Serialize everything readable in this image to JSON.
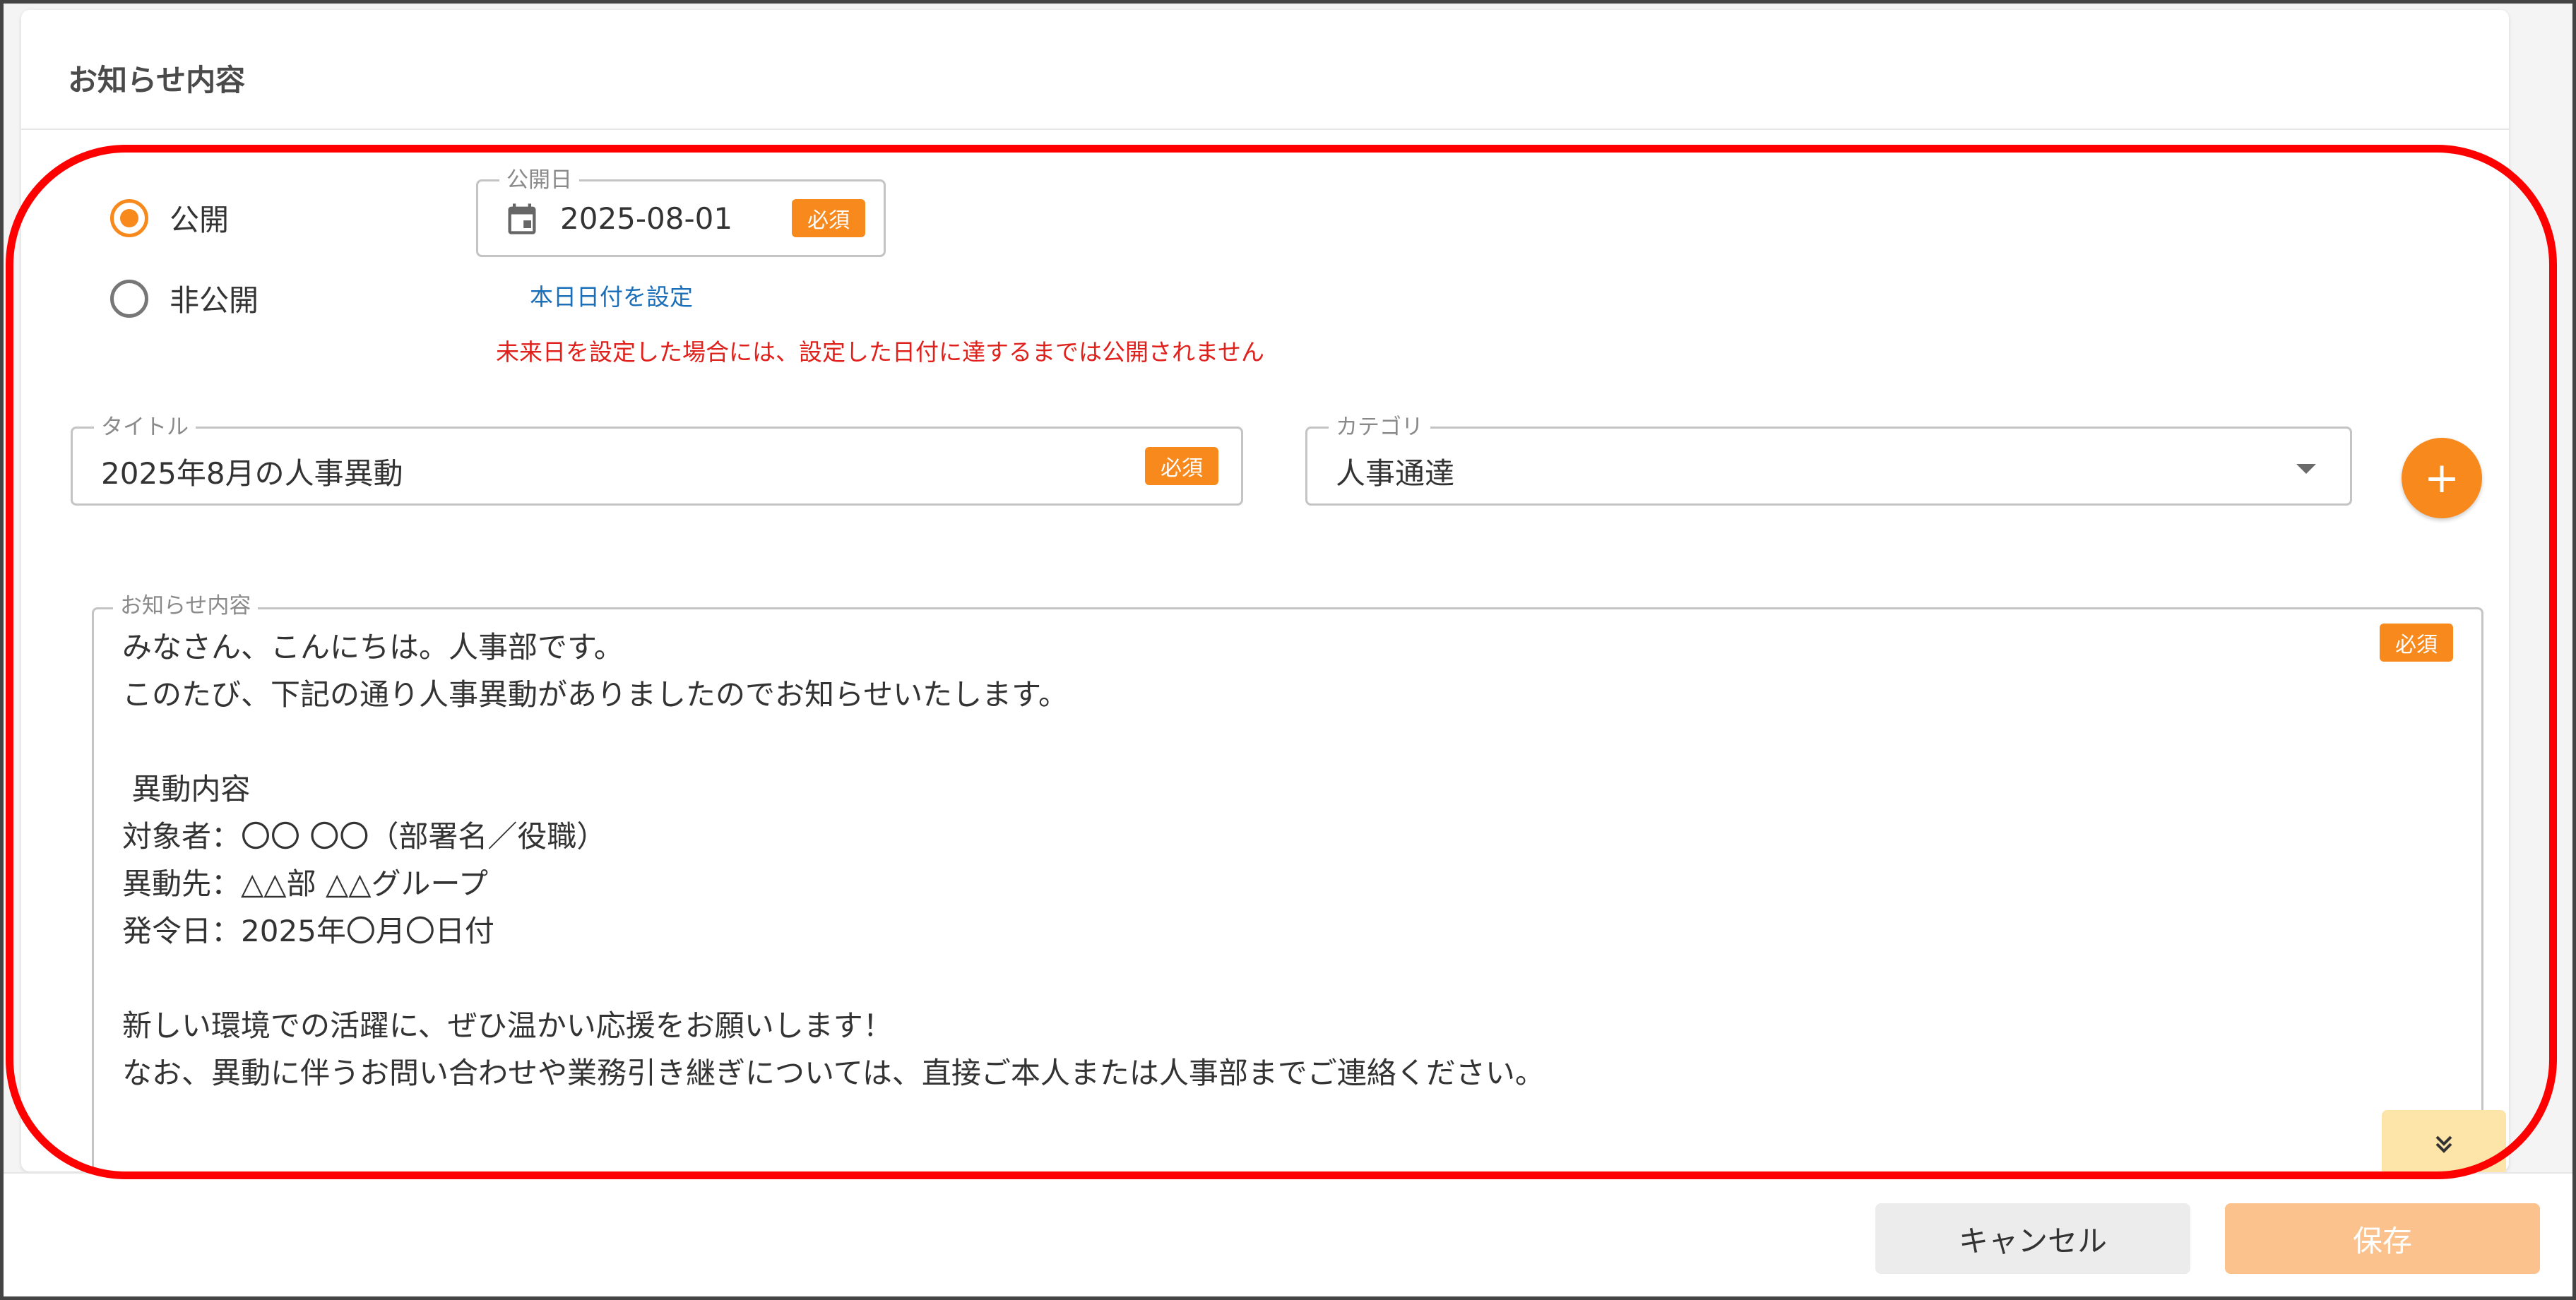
{
  "card": {
    "title": "お知らせ内容"
  },
  "visibility": {
    "options": [
      {
        "label": "公開",
        "checked": true
      },
      {
        "label": "非公開",
        "checked": false
      }
    ]
  },
  "publish_date": {
    "label": "公開日",
    "value": "2025-08-01",
    "required_badge": "必須",
    "today_link": "本日日付を設定",
    "warning": "未来日を設定した場合には、設定した日付に達するまでは公開されません"
  },
  "title_field": {
    "label": "タイトル",
    "value": "2025年8月の人事異動",
    "required_badge": "必須"
  },
  "category_field": {
    "label": "カテゴリ",
    "value": "人事通達"
  },
  "add_category_button": {
    "label": "+"
  },
  "content_field": {
    "label": "お知らせ内容",
    "required_badge": "必須",
    "value": "みなさん、こんにちは。人事部です。\nこのたび、下記の通り人事異動がありましたのでお知らせいたします。\n\n 異動内容\n対象者：〇〇 〇〇（部署名／役職）\n異動先：△△部 △△グループ\n発令日：2025年〇月〇日付\n\n新しい環境での活躍に、ぜひ温かい応援をお願いします！\nなお、異動に伴うお問い合わせや業務引き継ぎについては、直接ご本人または人事部までご連絡ください。\n\n________________________________________"
  },
  "footer": {
    "cancel_label": "キャンセル",
    "save_label": "保存"
  },
  "colors": {
    "accent": "#f7891d",
    "highlight": "#ff0000",
    "link": "#1b6fb8",
    "warning": "#e0201b"
  }
}
